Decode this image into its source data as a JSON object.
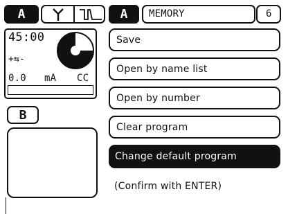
{
  "left_panel": {
    "tab_a_label": "A",
    "tab_b_label": "B",
    "timer": "45:00",
    "polarity": "+⇆-",
    "current_value": "0.0",
    "current_unit": "mA",
    "mode": "CC",
    "icons": [
      "branch-icon",
      "pulse-icon",
      "pie-progress-icon"
    ]
  },
  "header": {
    "channel": "A",
    "title": "MEMORY",
    "page": "6"
  },
  "menu": {
    "items": [
      {
        "label": "Save",
        "selected": false
      },
      {
        "label": "Open by name list",
        "selected": false
      },
      {
        "label": "Open by number",
        "selected": false
      },
      {
        "label": "Clear program",
        "selected": false
      },
      {
        "label": "Change default program",
        "selected": true
      }
    ],
    "hint": "(Confirm with ENTER)"
  }
}
